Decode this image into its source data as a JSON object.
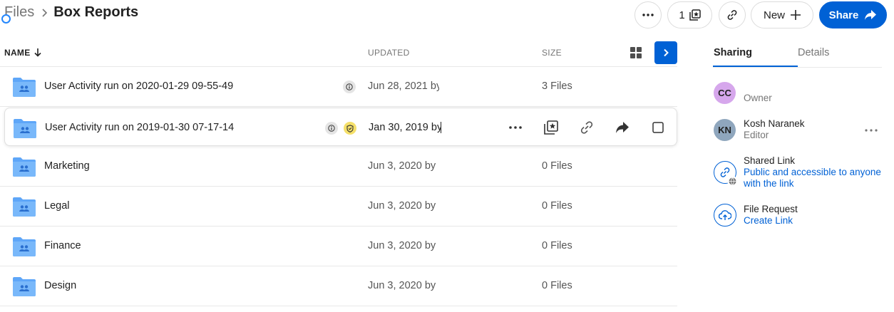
{
  "breadcrumb": {
    "root": "Files",
    "current": "Box Reports"
  },
  "header": {
    "more_label": "More options",
    "collections_count": "1",
    "new_label": "New",
    "share_label": "Share"
  },
  "table": {
    "columns": {
      "name": "NAME",
      "updated": "UPDATED",
      "size": "SIZE"
    },
    "rows": [
      {
        "name": "User Activity run on 2020-01-29 09-55-49",
        "updated": "Jun 28, 2021 by",
        "size": "3 Files",
        "badges": [
          "info"
        ]
      },
      {
        "name": "User Activity run on 2019-01-30 07-17-14",
        "updated": "Jan 30, 2019 by",
        "size": "",
        "badges": [
          "info",
          "shield"
        ]
      },
      {
        "name": "Marketing",
        "updated": "Jun 3, 2020 by",
        "size": "0 Files",
        "badges": []
      },
      {
        "name": "Legal",
        "updated": "Jun 3, 2020 by",
        "size": "0 Files",
        "badges": []
      },
      {
        "name": "Finance",
        "updated": "Jun 3, 2020 by",
        "size": "0 Files",
        "badges": []
      },
      {
        "name": "Design",
        "updated": "Jun 3, 2020 by",
        "size": "0 Files",
        "badges": []
      }
    ]
  },
  "sidebar": {
    "tabs": [
      "Sharing",
      "Details"
    ],
    "owner": {
      "initials": "CC",
      "role": "Owner",
      "color": "#d6a7ec"
    },
    "collaborator": {
      "initials": "KN",
      "name": "Kosh Naranek",
      "role": "Editor",
      "color": "#8fa6bd"
    },
    "shared_link": {
      "title": "Shared Link",
      "desc": "Public and accessible to anyone with the link"
    },
    "file_request": {
      "title": "File Request",
      "action": "Create Link"
    }
  },
  "colors": {
    "brand": "#0061d5",
    "folder": "#5ea6f8"
  }
}
